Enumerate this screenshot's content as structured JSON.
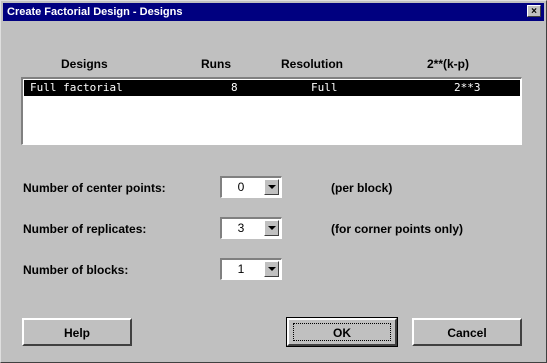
{
  "window": {
    "title": "Create Factorial Design - Designs",
    "close_glyph": "×"
  },
  "table": {
    "headers": [
      "Designs",
      "Runs",
      "Resolution",
      "2**(k-p)"
    ],
    "rows": [
      {
        "design": "Full factorial",
        "runs": "8",
        "resolution": "Full",
        "notation": "2**3"
      }
    ]
  },
  "fields": {
    "center_points": {
      "label": "Number of center points:",
      "value": "0",
      "note": "(per block)"
    },
    "replicates": {
      "label": "Number of replicates:",
      "value": "3",
      "note": "(for corner points only)"
    },
    "blocks": {
      "label": "Number of blocks:",
      "value": "1"
    }
  },
  "buttons": {
    "help": "Help",
    "ok": "OK",
    "cancel": "Cancel"
  },
  "icons": {
    "close": "close-icon",
    "dropdown": "chevron-down-icon"
  }
}
